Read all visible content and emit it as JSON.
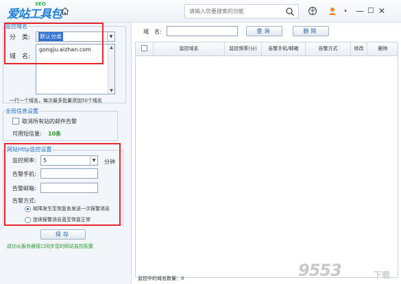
{
  "titlebar": {
    "logo_text": "爱站工具包",
    "logo_badge": "SEO",
    "search_placeholder": "请输入您要搜索的功能",
    "window_buttons": [
      "—",
      "☐",
      "✕"
    ]
  },
  "left": {
    "monitor_domain": {
      "title": "监控域名",
      "category_label": "分　类:",
      "category_value": "默认分类",
      "domain_label": "域　名:",
      "domain_value": "gongju.aizhan.com",
      "hint": "一行一个域名，每次最多批量添加50个域名"
    },
    "global": {
      "title": "全局信息设置",
      "cancel_alert_label": "取消所有站的邮件告警",
      "sms_label": "可用短信量:",
      "sms_value": "10条"
    },
    "http_monitor": {
      "title": "网站Http监控设置",
      "freq_label": "监控频率:",
      "freq_value": "5",
      "freq_unit": "分钟",
      "phone_label": "告警手机:",
      "phone_value": "",
      "email_label": "告警邮箱:",
      "email_value": "",
      "mode_label": "告警方式:",
      "mode_options": [
        "故障发生至恢复各发送一次报警消息",
        "连续报警消息直至恢复正常"
      ]
    },
    "save_label": "保存",
    "sync_status": "成功从服务器接口同步您的网站监控配置"
  },
  "right": {
    "domain_filter_label": "域　名:",
    "domain_filter_value": "",
    "query_label": "查询",
    "delete_label": "删除",
    "columns": [
      "监控域名",
      "监控频率(分)",
      "告警手机/邮箱",
      "告警方式",
      "修改",
      "删除"
    ],
    "count_label": "监控中的域名数量：0"
  },
  "watermark": {
    "text": "9553",
    "sub": "下载"
  },
  "colors": {
    "red_highlight": "#e8232b",
    "accent_blue": "#1f7fd6",
    "status_green": "#2c9a2c"
  }
}
